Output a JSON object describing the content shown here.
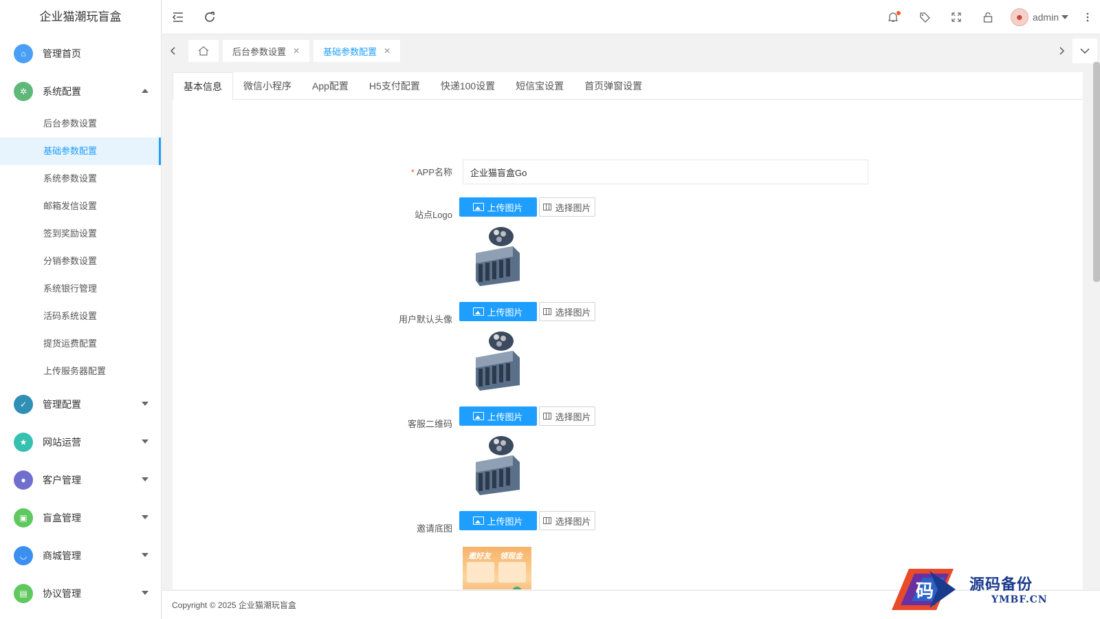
{
  "app": {
    "title": "企业猫潮玩盲盒"
  },
  "sidebar": {
    "items": [
      {
        "label": "管理首页",
        "color": "#4a9ff5"
      },
      {
        "label": "系统配置",
        "color": "#5fb878"
      },
      {
        "label": "管理配置",
        "color": "#2f8fb5"
      },
      {
        "label": "网站运营",
        "color": "#36c0b0"
      },
      {
        "label": "客户管理",
        "color": "#6f6fcf"
      },
      {
        "label": "盲盒管理",
        "color": "#5fc85f"
      },
      {
        "label": "商城管理",
        "color": "#3a8ff0"
      },
      {
        "label": "协议管理",
        "color": "#5fc85f"
      }
    ],
    "sub_items": [
      "后台参数设置",
      "基础参数配置",
      "系统参数设置",
      "邮箱发信设置",
      "签到奖励设置",
      "分销参数设置",
      "系统银行管理",
      "活码系统设置",
      "提货运费配置",
      "上传服务器配置"
    ]
  },
  "header": {
    "username": "admin"
  },
  "page_tabs": [
    {
      "label": "后台参数设置"
    },
    {
      "label": "基础参数配置"
    }
  ],
  "content_tabs": [
    "基本信息",
    "微信小程序",
    "App配置",
    "H5支付配置",
    "快递100设置",
    "短信宝设置",
    "首页弹窗设置"
  ],
  "form": {
    "app_name_label": "APP名称",
    "app_name_value": "企业猫盲盒Go",
    "upload_label": "上传图片",
    "select_label": "选择图片",
    "fields": [
      "站点Logo",
      "用户默认头像",
      "客服二维码",
      "邀请底图"
    ],
    "invite_text1": "邀好友",
    "invite_text2": "领现金"
  },
  "footer": {
    "copyright": "Copyright © 2025 企业猫潮玩盲盒"
  },
  "watermark": {
    "line1": "源码备份",
    "line2": "YMBF.CN",
    "glyph": "码"
  }
}
